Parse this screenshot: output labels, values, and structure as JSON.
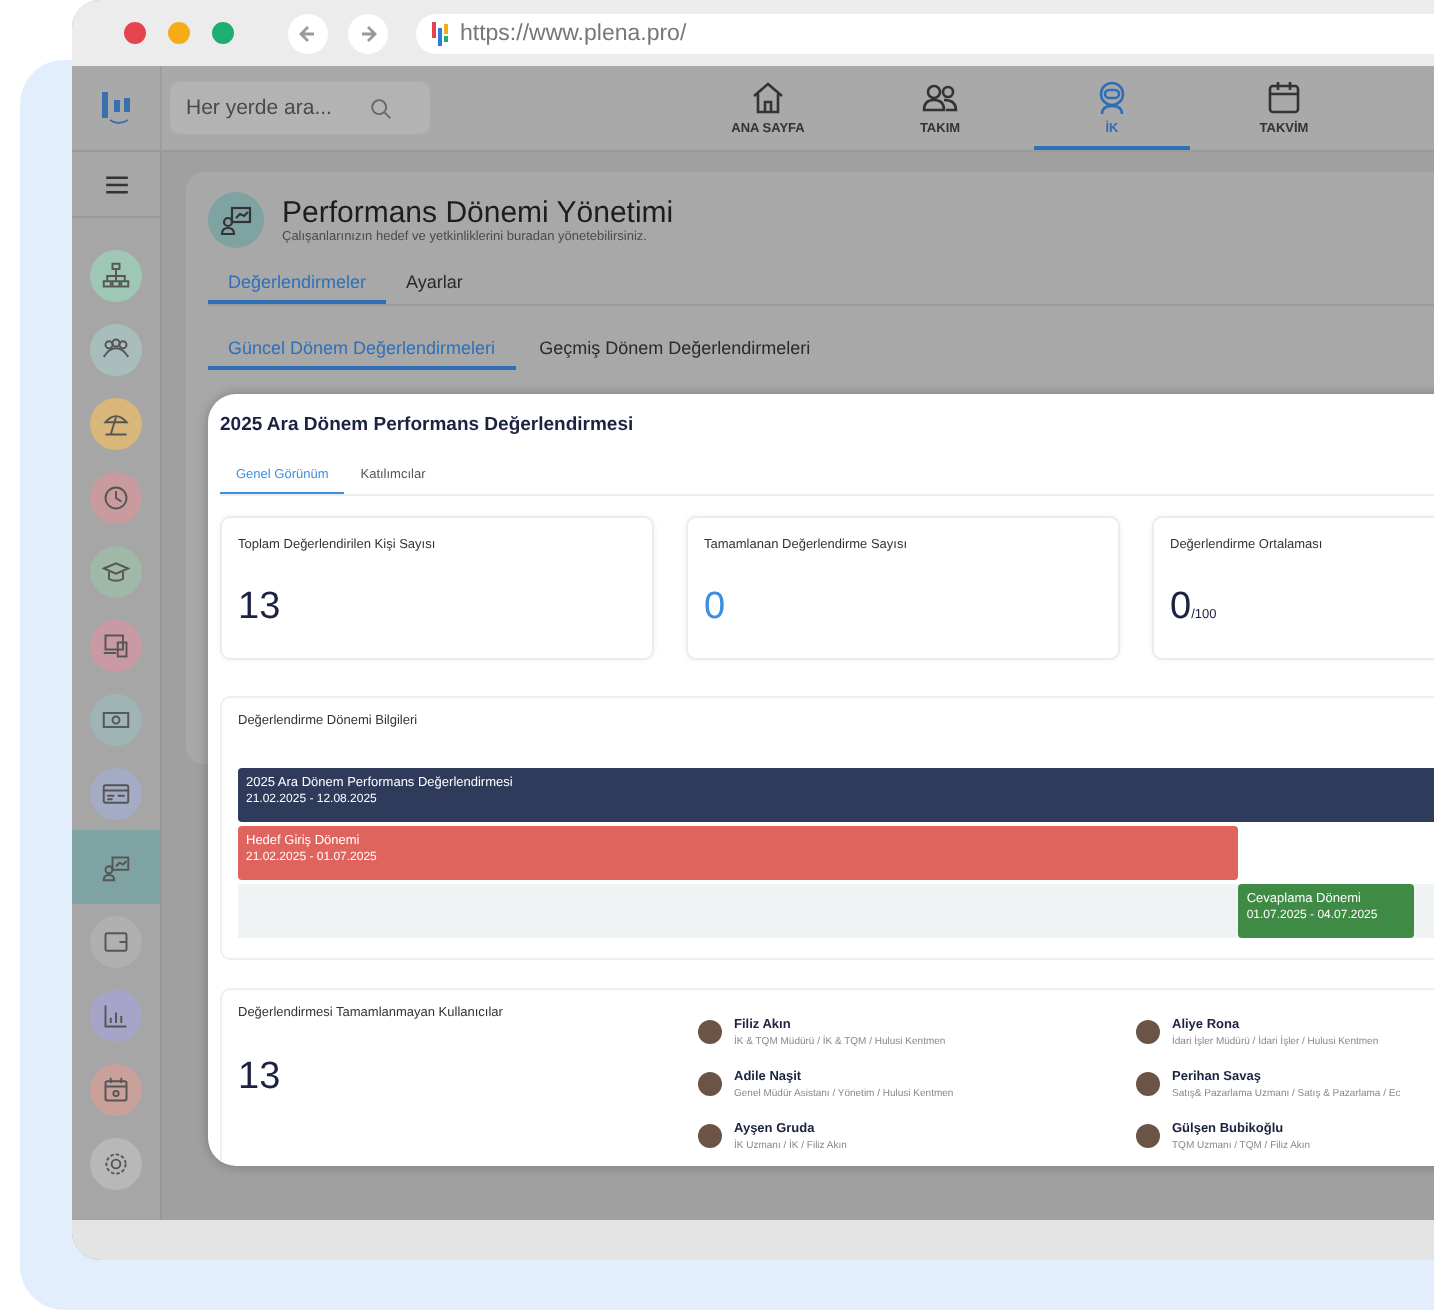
{
  "browser": {
    "url": "https://www.plena.pro/"
  },
  "topbar": {
    "search": {
      "placeholder": "Her yerde ara..."
    },
    "nav": [
      {
        "label": "ANA SAYFA",
        "selected": false
      },
      {
        "label": "TAKIM",
        "selected": false
      },
      {
        "label": "İK",
        "selected": true
      },
      {
        "label": "TAKVİM",
        "selected": false
      }
    ]
  },
  "sidebar": {
    "items": [
      {
        "color": "#9fc7b6",
        "selected": false
      },
      {
        "color": "#a9bdbd",
        "selected": false
      },
      {
        "color": "#d9b67a",
        "selected": false
      },
      {
        "color": "#c99a9e",
        "selected": false
      },
      {
        "color": "#9fb8a8",
        "selected": false
      },
      {
        "color": "#c99aa4",
        "selected": false
      },
      {
        "color": "#9fb5b5",
        "selected": false
      },
      {
        "color": "#a3acc4",
        "selected": false
      },
      {
        "color": "#7fa3a3",
        "selected": true
      },
      {
        "color": "#b0b0b0",
        "selected": false
      },
      {
        "color": "#a7a4c9",
        "selected": false
      },
      {
        "color": "#c9a09a",
        "selected": false
      },
      {
        "color": "#b8b8b8",
        "selected": false
      }
    ]
  },
  "page": {
    "title": "Performans Dönemi Yönetimi",
    "subtitle": "Çalışanlarınızın hedef ve yetkinliklerini buradan yönetebilirsiniz.",
    "tabs": [
      {
        "label": "Değerlendirmeler",
        "selected": true
      },
      {
        "label": "Ayarlar",
        "selected": false
      }
    ],
    "subtabs": [
      {
        "label": "Güncel Dönem Değerlendirmeleri",
        "selected": true
      },
      {
        "label": "Geçmiş Dönem Değerlendirmeleri",
        "selected": false
      }
    ]
  },
  "dialog": {
    "title": "2025 Ara Dönem Performans Değerlendirmesi",
    "tabs": [
      {
        "label": "Genel Görünüm",
        "selected": true
      },
      {
        "label": "Katılımcılar",
        "selected": false
      }
    ],
    "stats": [
      {
        "label": "Toplam Değerlendirilen Kişi Sayısı",
        "value": "13",
        "color": "#1c2340"
      },
      {
        "label": "Tamamlanan Değerlendirme Sayısı",
        "value": "0",
        "color": "#3d8fe0"
      },
      {
        "label": "Değerlendirme Ortalaması",
        "value": "0",
        "suffix": "/100",
        "color": "#1c2340"
      }
    ],
    "timeline": {
      "title": "Değerlendirme Dönemi Bilgileri",
      "bars": [
        {
          "name": "2025 Ara Dönem Performans Değerlendirmesi",
          "dates": "21.02.2025 - 12.08.2025",
          "color": "#2f3b5a"
        },
        {
          "name": "Hedef Giriş Dönemi",
          "dates": "21.02.2025 - 01.07.2025",
          "color": "#e0645e"
        },
        {
          "name": "Cevaplama Dönemi",
          "dates": "01.07.2025 - 04.07.2025",
          "color": "#3f8a45"
        }
      ]
    },
    "pending": {
      "title": "Değerlendirmesi Tamamlanmayan Kullanıcılar",
      "count": "13",
      "people": [
        {
          "name": "Filiz Akın",
          "role": "İK & TQM Müdürü / İK & TQM / Hulusi Kentmen"
        },
        {
          "name": "Adile Naşit",
          "role": "Genel Müdür Asistanı / Yönetim / Hulusi Kentmen"
        },
        {
          "name": "Ayşen Gruda",
          "role": "İK Uzmanı / İK / Filiz Akın"
        },
        {
          "name": "Aliye Rona",
          "role": "İdari İşler Müdürü / İdari İşler / Hulusi Kentmen"
        },
        {
          "name": "Perihan Savaş",
          "role": "Satış& Pazarlama Uzmanı / Satış & Pazarlama / Ec"
        },
        {
          "name": "Gülşen Bubikoğlu",
          "role": "TQM Uzmanı / TQM / Filiz Akın"
        }
      ]
    }
  }
}
